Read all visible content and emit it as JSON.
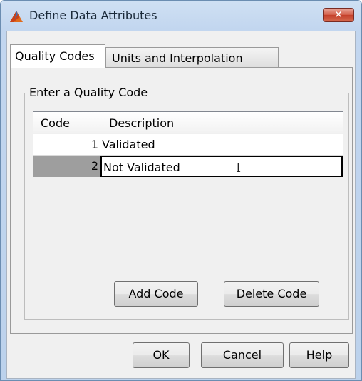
{
  "window": {
    "title": "Define Data Attributes",
    "close_label": "✕"
  },
  "tabs": [
    {
      "label": "Quality Codes",
      "active": true
    },
    {
      "label": "Units and Interpolation",
      "active": false
    }
  ],
  "group": {
    "label": "Enter a Quality Code"
  },
  "table": {
    "columns": [
      "Code",
      "Description"
    ],
    "rows": [
      {
        "code": "1",
        "description": "Validated"
      },
      {
        "code": "2",
        "description": "Not Validated"
      }
    ]
  },
  "buttons": {
    "add_code": "Add Code",
    "delete_code": "Delete Code",
    "ok": "OK",
    "cancel": "Cancel",
    "help": "Help"
  },
  "colors": {
    "title_bar": "#c2d6ef",
    "close_button": "#c43f2a",
    "selected_row_code": "#9e9e9e"
  }
}
